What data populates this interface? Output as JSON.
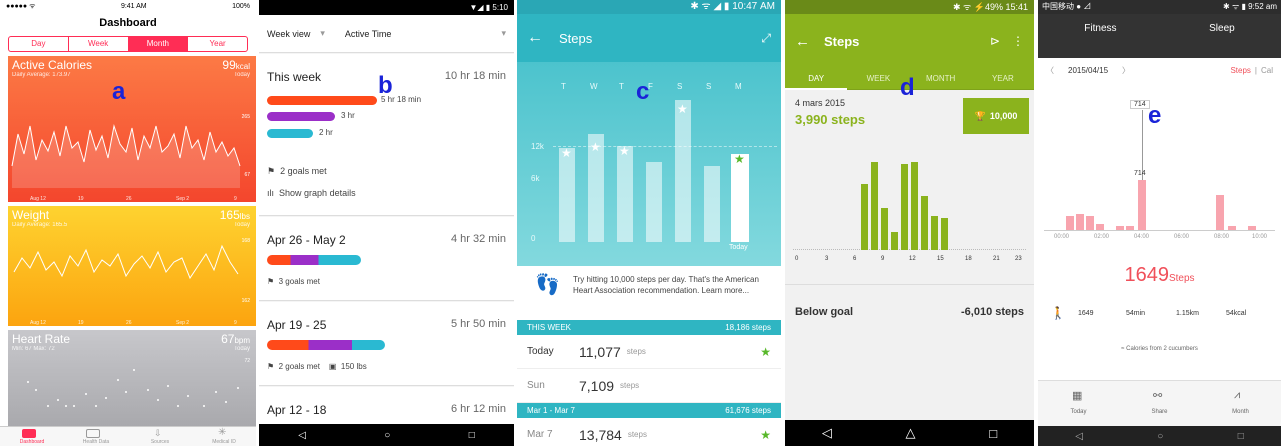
{
  "labels": {
    "a": "a",
    "b": "b",
    "c": "c",
    "d": "d",
    "e": "e"
  },
  "a": {
    "status": {
      "carrier": "●●●●● ᯤ",
      "time": "9:41 AM",
      "battery": "100%"
    },
    "title": "Dashboard",
    "segments": [
      "Day",
      "Week",
      "Month",
      "Year"
    ],
    "selected_segment": "Month",
    "calories": {
      "title": "Active Calories",
      "value": "99",
      "unit": "kcal",
      "sub": "Daily Average: 173.97",
      "today": "Today",
      "max": "265",
      "min": "67",
      "axis": [
        "Aug 12",
        "19",
        "26",
        "Sep 2",
        "9"
      ]
    },
    "weight": {
      "title": "Weight",
      "value": "165",
      "unit": "lbs",
      "sub": "Daily Average: 165.5",
      "today": "Today",
      "max": "168",
      "min": "162",
      "axis": [
        "Aug 12",
        "19",
        "26",
        "Sep 2",
        "9"
      ]
    },
    "heart": {
      "title": "Heart Rate",
      "value": "67",
      "unit": "bpm",
      "sub": "Min: 67  Max: 72",
      "today": "Today",
      "max": "72"
    },
    "tabs": [
      "Dashboard",
      "Health Data",
      "Sources",
      "Medical ID"
    ],
    "colors": {
      "accent": "#ff2d55",
      "calories": "#f7603f",
      "weight": "#fdbb13",
      "heart": "#b9b9bd"
    }
  },
  "b": {
    "status": "▼◢ ▮ 5:10",
    "filter1": "Week view",
    "filter2": "Active Time",
    "this_week": {
      "title": "This week",
      "total": "10 hr 18 min",
      "bar1": "5 hr 18 min",
      "bar2": "3 hr",
      "bar3": "2 hr",
      "goals": "2 goals met",
      "graph": "Show graph details"
    },
    "weeks": [
      {
        "title": "Apr 26 - May 2",
        "total": "4 hr 32 min",
        "goals": "3 goals met",
        "weight": ""
      },
      {
        "title": "Apr 19 - 25",
        "total": "5 hr 50 min",
        "goals": "2 goals met",
        "weight": "150 lbs"
      },
      {
        "title": "Apr 12 - 18",
        "total": "6 hr 12 min",
        "goals": "",
        "weight": ""
      }
    ],
    "colors": {
      "red": "#ff4a1a",
      "purple": "#9b2fc8",
      "teal": "#2ab9d2"
    }
  },
  "c": {
    "status": "✱ ᯤ ◢ ▮ 10:47 AM",
    "title": "Steps",
    "days": [
      "T",
      "W",
      "T",
      "F",
      "S",
      "S",
      "M"
    ],
    "yticks": [
      "12k",
      "6k",
      "0"
    ],
    "today": "Today",
    "message": "Try hitting 10,000 steps per day. That's the American Heart Association recommendation. Learn more...",
    "this_week": {
      "label": "THIS WEEK",
      "total": "18,186 steps"
    },
    "rows": [
      {
        "day": "Today",
        "steps": "11,077",
        "unit": "steps"
      },
      {
        "day": "Sun",
        "steps": "7,109",
        "unit": "steps"
      }
    ],
    "mar": {
      "label": "Mar 1 - Mar 7",
      "total": "61,676 steps"
    },
    "mar_row": {
      "day": "Mar 7",
      "steps": "13,784",
      "unit": "steps"
    }
  },
  "d": {
    "status": "✱ ᯤ ⚡49% 15:41",
    "title": "Steps",
    "tabs": [
      "DAY",
      "WEEK",
      "MONTH",
      "YEAR"
    ],
    "date": "4 mars 2015",
    "steps": "3,990 steps",
    "goal": "10,000",
    "xticks": [
      "0",
      "3",
      "6",
      "9",
      "12",
      "15",
      "18",
      "21",
      "23"
    ],
    "bar_labels": [
      "503",
      "825",
      "237",
      "28",
      "776",
      "825",
      "355",
      "170",
      "156"
    ],
    "below": "Below goal",
    "diff": "-6,010 steps"
  },
  "e": {
    "status_left": "中国移动 ● ⊿",
    "status_right": "✱ ᯤ ▮ 9:52 am",
    "tabs": [
      "Fitness",
      "Sleep"
    ],
    "date": "2015/04/15",
    "toggle_steps": "Steps",
    "toggle_cal": "Cal",
    "peak": "714",
    "peak2": "714",
    "xticks": [
      "00:00",
      "02:00",
      "04:00",
      "06:00",
      "08:00",
      "10:00"
    ],
    "steps": "1649",
    "steps_unit": "Steps",
    "stats": [
      "1649",
      "54min",
      "1.15km",
      "54kcal"
    ],
    "calories_note": "≈ Calories from 2 cucumbers",
    "nav": [
      "Today",
      "Share",
      "Month"
    ]
  }
}
